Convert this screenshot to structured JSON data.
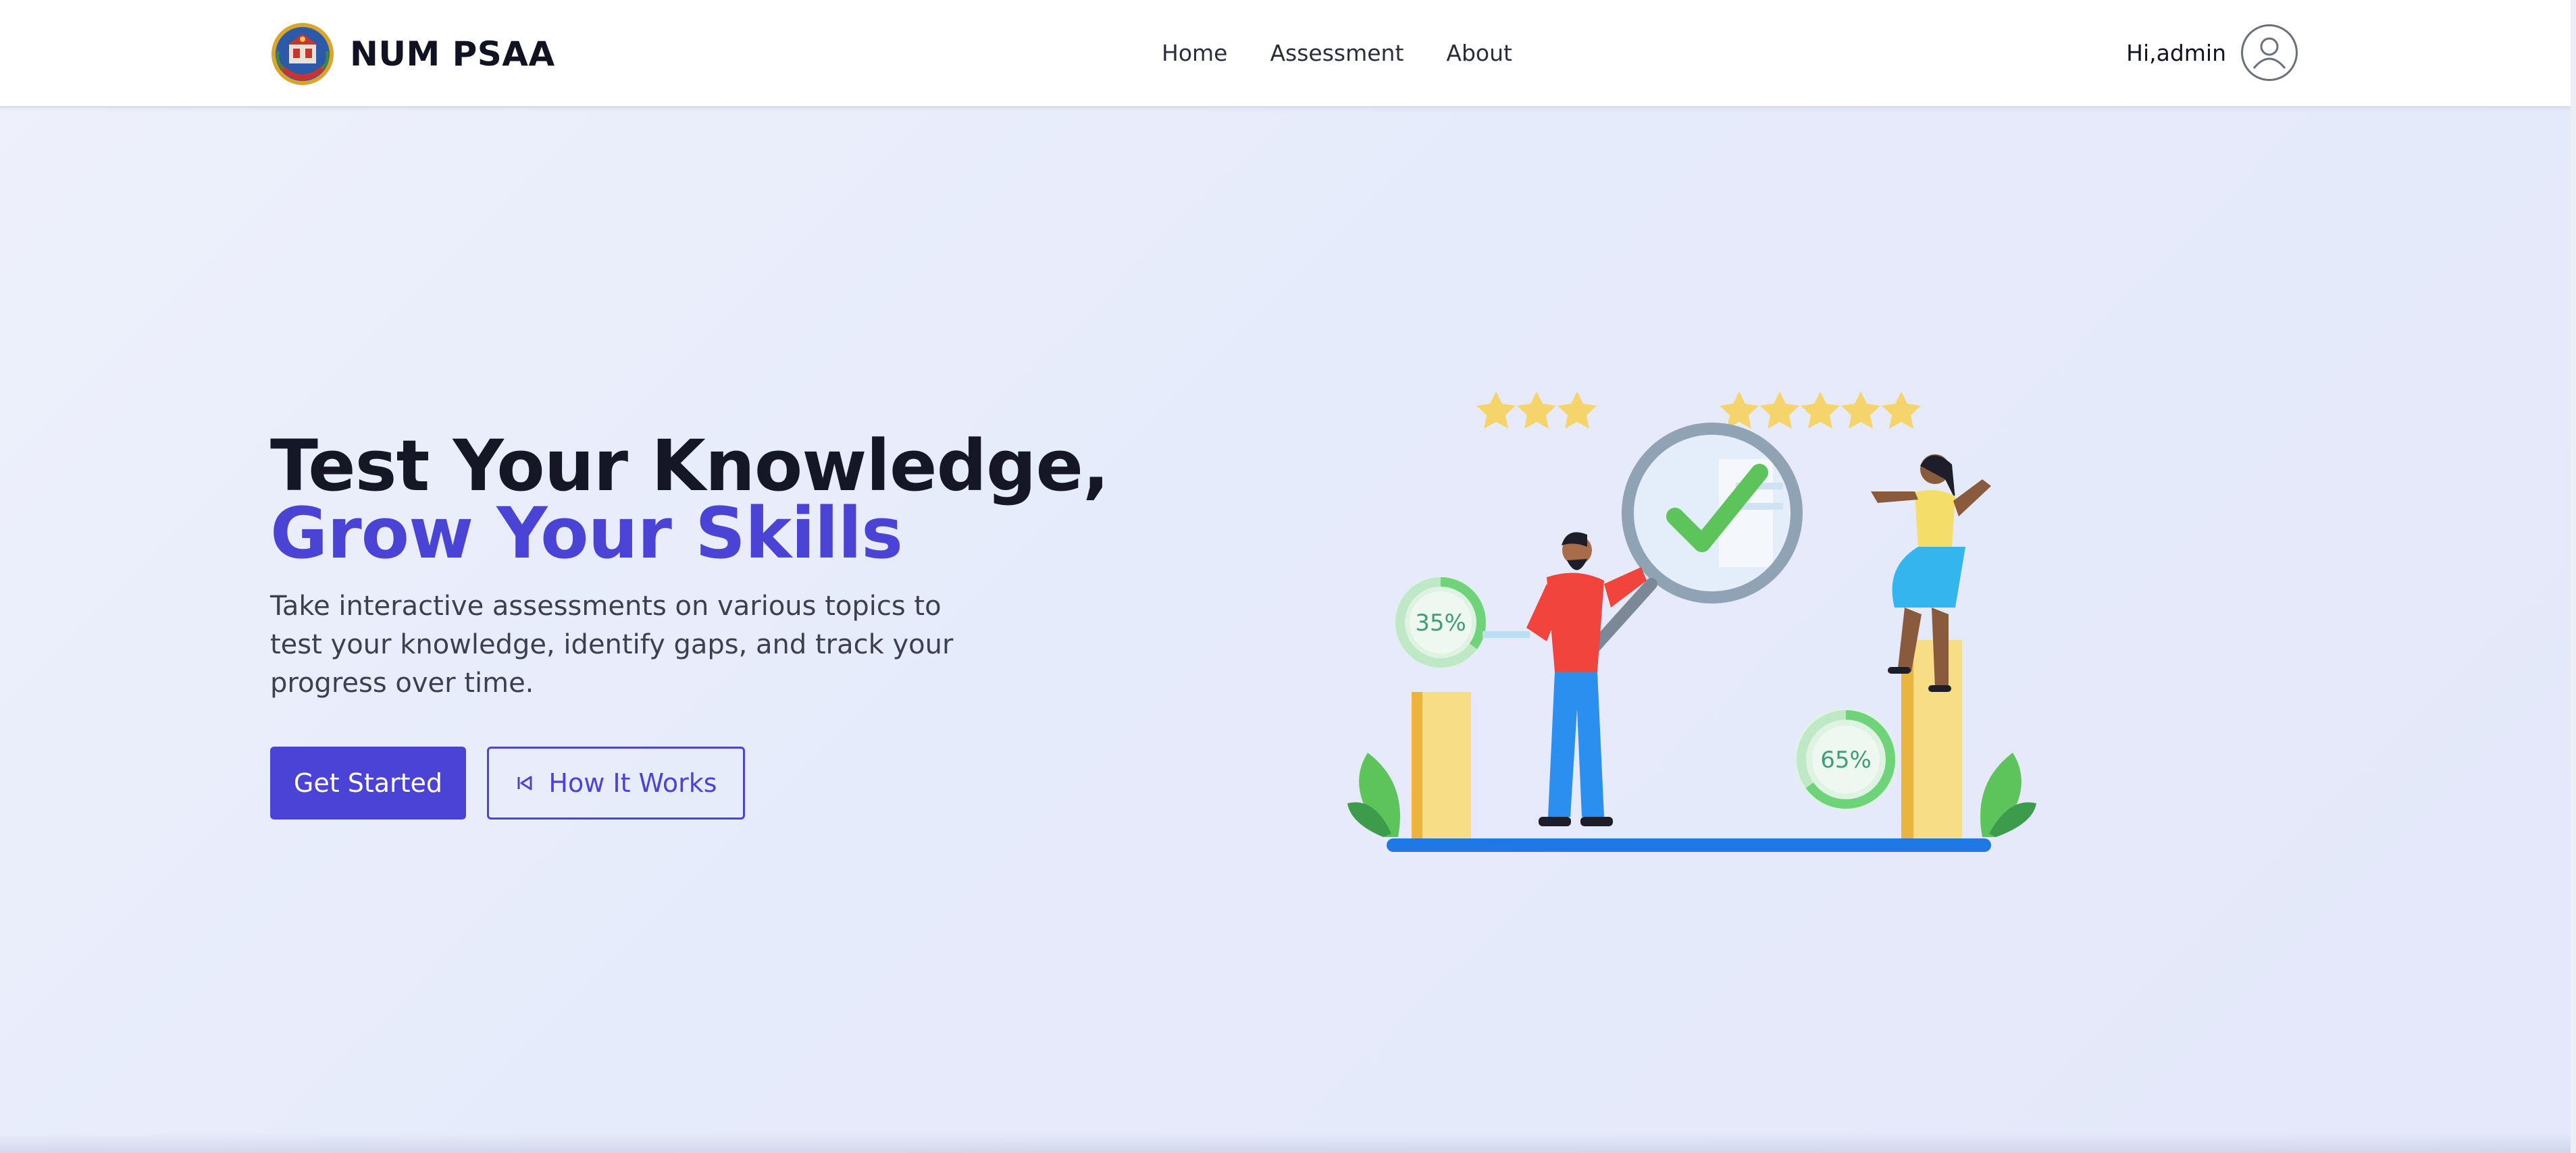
{
  "header": {
    "brand_name": "NUM PSAA",
    "nav": [
      {
        "label": "Home"
      },
      {
        "label": "Assessment"
      },
      {
        "label": "About"
      }
    ],
    "greeting": "Hi,admin",
    "avatar_icon": "user-circle-icon"
  },
  "hero": {
    "title_part1": "Test Your Knowledge,",
    "title_part2": "Grow Your Skills",
    "subtitle": "Take interactive assessments on various topics to test your knowledge, identify gaps, and track your progress over time.",
    "primary_button": "Get Started",
    "secondary_button": "How It Works",
    "secondary_icon": "play-back-icon"
  },
  "illustration": {
    "left_percent": "35%",
    "right_percent": "65%",
    "left_stars": 3,
    "right_stars": 5
  },
  "colors": {
    "accent": "#4a43d6",
    "title": "#151726",
    "header_bg": "#ffffff"
  }
}
